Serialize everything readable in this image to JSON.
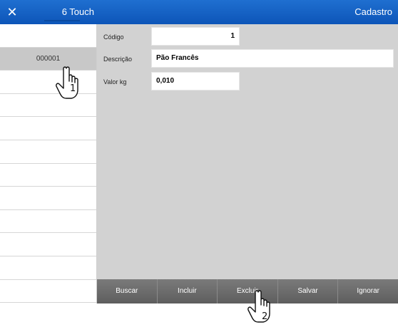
{
  "titlebar": {
    "close_icon": "close-icon",
    "app_name": "6 Touch",
    "screen_title": "Cadastro"
  },
  "record_list": {
    "rows": [
      "",
      "000001",
      "",
      "",
      "",
      "",
      "",
      "",
      "",
      "",
      "",
      ""
    ],
    "selected_index": 1
  },
  "form": {
    "codigo": {
      "label": "Código",
      "value": "1"
    },
    "descricao": {
      "label": "Descrição",
      "value": "Pão Francês"
    },
    "valor_kg": {
      "label": "Valor kg",
      "value": "0,010"
    }
  },
  "toolbar": {
    "buscar": "Buscar",
    "incluir": "Incluir",
    "excluir": "Excluir",
    "salvar": "Salvar",
    "ignorar": "Ignorar"
  },
  "pointers": [
    {
      "icon": "hand-pointer-icon",
      "step": "1"
    },
    {
      "icon": "hand-pointer-icon",
      "step": "2"
    }
  ]
}
